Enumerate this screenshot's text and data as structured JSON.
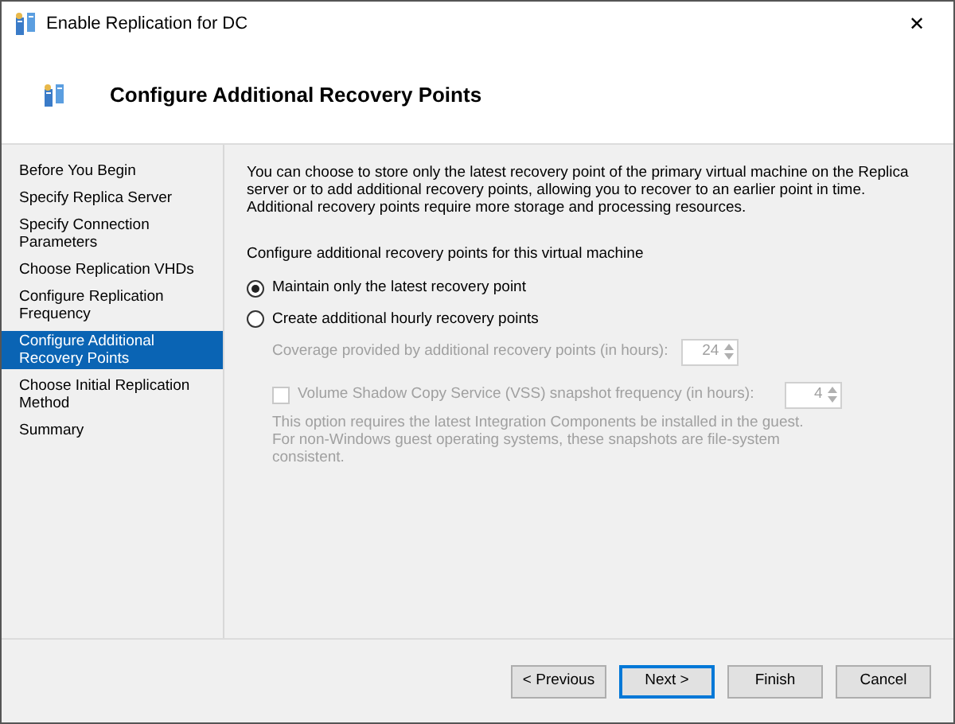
{
  "window": {
    "title": "Enable Replication for DC",
    "close": "✕"
  },
  "header": {
    "title": "Configure Additional Recovery Points"
  },
  "sidebar": {
    "items": [
      {
        "label": "Before You Begin",
        "selected": false
      },
      {
        "label": "Specify Replica Server",
        "selected": false
      },
      {
        "label": "Specify Connection Parameters",
        "selected": false
      },
      {
        "label": "Choose Replication VHDs",
        "selected": false
      },
      {
        "label": "Configure Replication Frequency",
        "selected": false
      },
      {
        "label": "Configure Additional Recovery Points",
        "selected": true
      },
      {
        "label": "Choose Initial Replication Method",
        "selected": false
      },
      {
        "label": "Summary",
        "selected": false
      }
    ]
  },
  "content": {
    "description": "You can choose to store only the latest recovery point of the primary virtual machine on the Replica server or to add additional recovery points, allowing you to recover to an earlier point in time. Additional recovery points require more storage and processing resources.",
    "section_label": "Configure additional recovery points for this virtual machine",
    "options": [
      {
        "label": "Maintain only the latest recovery point",
        "selected": true
      },
      {
        "label": "Create additional hourly recovery points",
        "selected": false
      }
    ],
    "coverage": {
      "label": "Coverage provided by additional recovery points (in hours):",
      "value": "24",
      "disabled": true
    },
    "vss": {
      "label": "Volume Shadow Copy Service (VSS) snapshot frequency (in hours):",
      "value": "4",
      "checked": false,
      "disabled": true
    },
    "note": "This option requires the latest Integration Components be installed in the guest. For non-Windows guest operating systems, these snapshots are file-system consistent."
  },
  "buttons": [
    {
      "label": "< Previous",
      "default": false
    },
    {
      "label": "Next >",
      "default": true
    },
    {
      "label": "Finish",
      "default": false
    },
    {
      "label": "Cancel",
      "default": false
    }
  ]
}
